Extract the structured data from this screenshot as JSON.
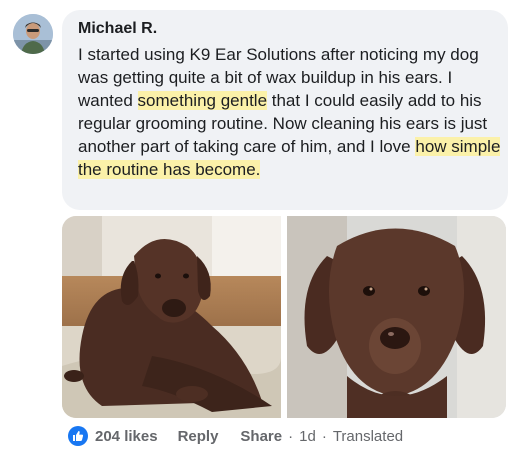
{
  "comment": {
    "author": "Michael R.",
    "text_parts": [
      "I started using K9 Ear Solutions after noticing my dog was getting quite a bit of wax buildup in his ears. I wanted ",
      "something gentle",
      " that I could easily add to his regular grooming routine. Now cleaning his ears is just another part of taking care of him, and I love ",
      "how simple the routine has become."
    ],
    "highlight_color": "#fbf1a9",
    "bubble_color": "#f0f2f5"
  },
  "actions": {
    "like_icon": "thumbs-up-icon",
    "likes": "204 likes",
    "reply": "Reply",
    "share": "Share",
    "separator": "·",
    "time": "1d",
    "separator2": "·",
    "translated": "Translated",
    "accent_color": "#1877f2",
    "muted_color": "#65676b"
  },
  "photos": [
    {
      "name": "chocolate-labrador-lying-on-rug"
    },
    {
      "name": "chocolate-labrador-face-closeup"
    }
  ]
}
